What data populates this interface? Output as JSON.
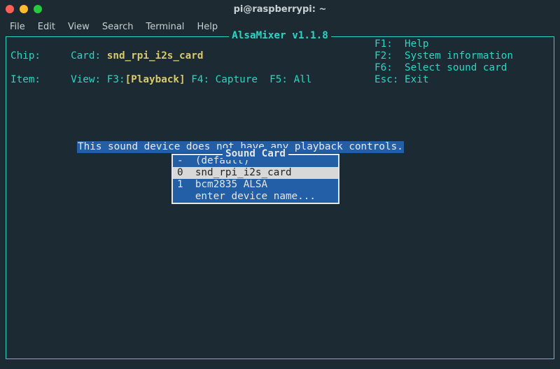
{
  "window": {
    "title": "pi@raspberrypi: ~"
  },
  "menubar": {
    "items": [
      "File",
      "Edit",
      "View",
      "Search",
      "Terminal",
      "Help"
    ]
  },
  "alsamixer": {
    "frame_title": " AlsaMixer v1.1.8 ",
    "left": {
      "card_label": "Card: ",
      "card_value": "snd_rpi_i2s_card",
      "chip_label": "Chip:",
      "view_label": "View: ",
      "f3": "F3:",
      "f3_value": "[Playback]",
      "f4": "F4: Capture",
      "f5": "F5: All",
      "item_label": "Item:"
    },
    "right": {
      "f1": "F1:  Help",
      "f2": "F2:  System information",
      "f6": "F6:  Select sound card",
      "esc": "Esc: Exit"
    },
    "message": "This sound device does not have any playback controls.",
    "popup": {
      "title": " Sound Card ",
      "rows": [
        {
          "id": "-",
          "label": "(default)",
          "selected": false
        },
        {
          "id": "0",
          "label": "snd_rpi_i2s_card",
          "selected": true
        },
        {
          "id": "1",
          "label": "bcm2835 ALSA",
          "selected": false
        },
        {
          "id": " ",
          "label": "enter device name...",
          "selected": false
        }
      ]
    }
  }
}
